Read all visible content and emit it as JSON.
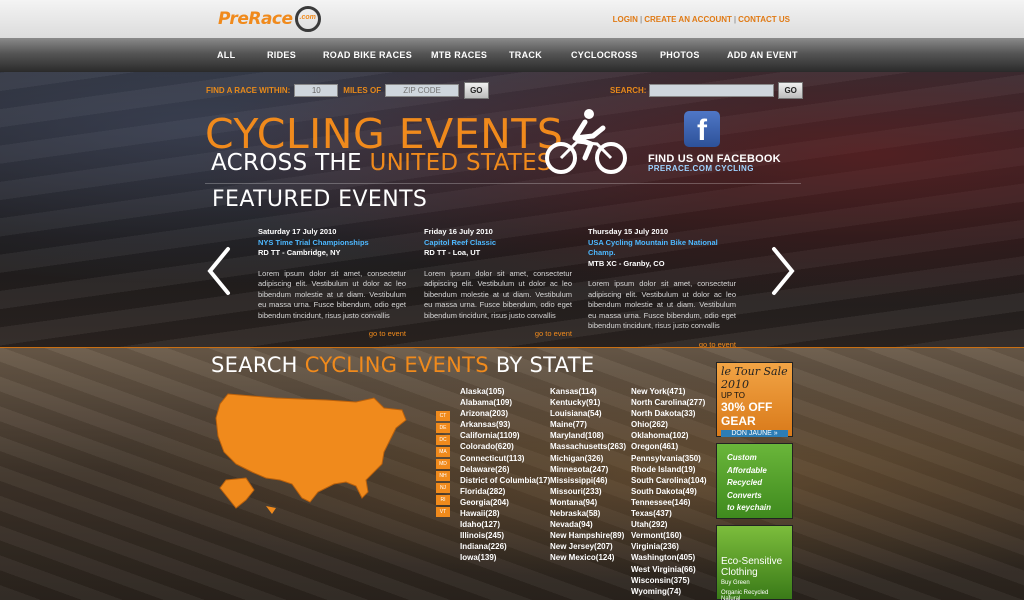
{
  "brand": {
    "logo_text": "PreRace",
    "logo_badge": ".com"
  },
  "account_links": [
    "LOGIN",
    "CREATE AN ACCOUNT",
    "CONTACT US"
  ],
  "nav": [
    "ALL",
    "RIDES",
    "ROAD BIKE RACES",
    "MTB RACES",
    "TRACK",
    "CYCLOCROSS",
    "PHOTOS",
    "ADD AN EVENT"
  ],
  "search": {
    "find_label": "FIND A RACE WITHIN:",
    "miles_value": "10",
    "miles_label": "MILES OF",
    "zip_placeholder": "ZIP CODE",
    "go": "GO",
    "search_label": "SEARCH:",
    "search_value": ""
  },
  "hero": {
    "line1": "CYCLING EVENTS",
    "line2_prefix": "ACROSS THE",
    "line2_highlight": "UNITED STATES",
    "fb_text1": "FIND US ON FACEBOOK",
    "fb_text2": "PRERACE.COM CYCLING"
  },
  "featured": {
    "title": "FEATURED EVENTS",
    "events": [
      {
        "date": "Saturday 17 July 2010",
        "name": "NYS Time Trial Championships",
        "location": "RD TT - Cambridge, NY",
        "desc": "Lorem ipsum dolor sit amet, consectetur adipiscing elit. Vestibulum ut dolor ac leo bibendum molestie at ut diam. Vestibulum eu massa urna. Fusce bibendum, odio eget bibendum tincidunt, risus justo convallis",
        "link": "go to event"
      },
      {
        "date": "Friday 16 July 2010",
        "name": "Capitol Reef Classic",
        "location": "RD TT - Loa, UT",
        "desc": "Lorem ipsum dolor sit amet, consectetur adipiscing elit. Vestibulum ut dolor ac leo bibendum molestie at ut diam. Vestibulum eu massa urna. Fusce bibendum, odio eget bibendum tincidunt, risus justo convallis",
        "link": "go to event"
      },
      {
        "date": "Thursday 15 July 2010",
        "name": "USA Cycling Mountain Bike National Champ.",
        "location": "MTB XC - Granby, CO",
        "desc": "Lorem ipsum dolor sit amet, consectetur adipiscing elit. Vestibulum ut dolor ac leo bibendum molestie at ut diam. Vestibulum eu massa urna. Fusce bibendum, odio eget bibendum tincidunt, risus justo convallis",
        "link": "go to event"
      }
    ]
  },
  "states": {
    "title_prefix": "SEARCH",
    "title_highlight": "CYCLING EVENTS",
    "title_suffix": "BY STATE",
    "small_states": [
      "CT",
      "DE",
      "DC",
      "MA",
      "MD",
      "NH",
      "NJ",
      "RI",
      "VT"
    ],
    "col1": [
      "Alaska(105)",
      "Alabama(109)",
      "Arizona(203)",
      "Arkansas(93)",
      "California(1109)",
      "Colorado(620)",
      "Connecticut(113)",
      "Delaware(26)",
      "District of Columbia(17)",
      "Florida(282)",
      "Georgia(204)",
      "Hawaii(28)",
      "Idaho(127)",
      "Illinois(245)",
      "Indiana(226)",
      "Iowa(139)"
    ],
    "col2": [
      "Kansas(114)",
      "Kentucky(91)",
      "Louisiana(54)",
      "Maine(77)",
      "Maryland(108)",
      "Massachusetts(263)",
      "Michigan(326)",
      "Minnesota(247)",
      "Mississippi(46)",
      "Missouri(233)",
      "Montana(94)",
      "Nebraska(58)",
      "Nevada(94)",
      "New Hampshire(89)",
      "New Jersey(207)",
      "New Mexico(124)"
    ],
    "col3": [
      "New York(471)",
      "North Carolina(277)",
      "North Dakota(33)",
      "Ohio(262)",
      "Oklahoma(102)",
      "Oregon(461)",
      "Pennsylvania(350)",
      "Rhode Island(19)",
      "South Carolina(104)",
      "South Dakota(49)",
      "Tennessee(146)",
      "Texas(437)",
      "Utah(292)",
      "Vermont(160)",
      "Virginia(236)",
      "Washington(405)",
      "West Virginia(66)",
      "Wisconsin(375)",
      "Wyoming(74)"
    ]
  },
  "ads": {
    "ad1": {
      "line1": "le Tour Sale 2010",
      "line2": "UP TO",
      "line3": "30% OFF GEAR",
      "line4": "DON JAUNE »"
    },
    "ad2": {
      "lines": [
        "Custom",
        "Affordable",
        "Recycled",
        "Converts",
        "to keychain"
      ]
    },
    "ad3": {
      "line1": "Eco-Sensitive Clothing",
      "line2": "Buy Green",
      "line3": "Organic  Recycled  Natural"
    }
  },
  "colors": {
    "orange": "#f08a1c",
    "link_blue": "#4db8ff"
  }
}
